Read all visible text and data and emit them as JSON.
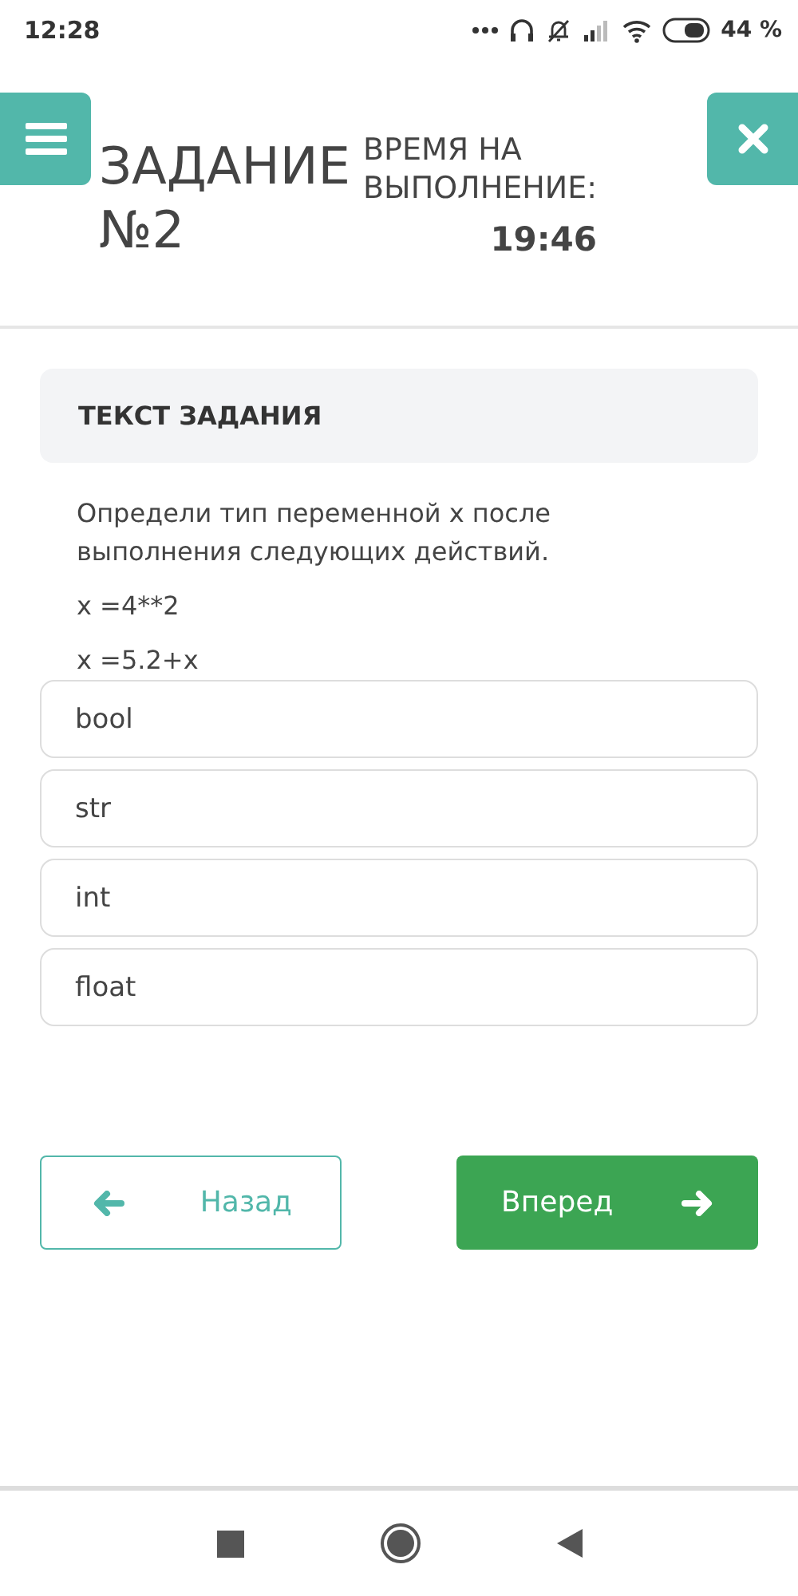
{
  "status_bar": {
    "time": "12:28",
    "battery": "44 %"
  },
  "header": {
    "title": [
      "ЗАДАНИЕ",
      "№2"
    ],
    "timer_label": [
      "ВРЕМЯ НА",
      "ВЫПОЛНЕНИЕ:"
    ],
    "timer": "19:46"
  },
  "task": {
    "heading": "ТЕКСТ ЗАДАНИЯ",
    "question": "Определи тип переменной x после выполнения следующих действий.",
    "code": [
      "x =4**2",
      "x =5.2+x"
    ]
  },
  "options": [
    {
      "label": "bool",
      "selected": false
    },
    {
      "label": "str",
      "selected": false
    },
    {
      "label": "int",
      "selected": false
    },
    {
      "label": "float",
      "selected": false
    }
  ],
  "nav": {
    "back": "Назад",
    "next": "Вперед"
  }
}
